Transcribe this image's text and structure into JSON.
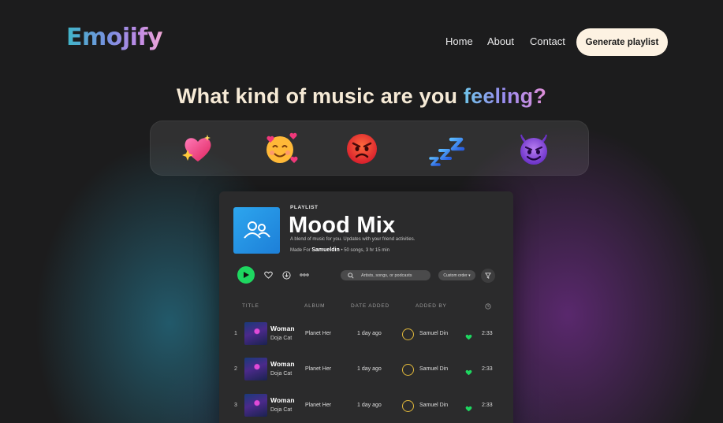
{
  "header": {
    "logo": "Emojify",
    "nav": [
      "Home",
      "About",
      "Contact"
    ],
    "cta": "Generate playlist"
  },
  "hero": {
    "question_main": "What kind of music are you ",
    "question_accent": "feeling?"
  },
  "moods": [
    {
      "icon": "sparkling-heart-icon"
    },
    {
      "icon": "smiling-face-with-hearts-icon"
    },
    {
      "icon": "angry-face-icon"
    },
    {
      "icon": "zzz-sleep-icon"
    },
    {
      "icon": "smiling-devil-icon"
    }
  ],
  "playlist": {
    "kicker": "PLAYLIST",
    "title": "Mood Mix",
    "description": "A blend of music for you. Updates with your friend activities.",
    "made_for_label": "Made For",
    "made_for_user": "Samueldin",
    "stats": "• 50 songs, 3 hr 15 min",
    "search_placeholder": "Artists, songs, or podcasts",
    "sort_label": "Custom order ▾",
    "columns": {
      "title": "TITLE",
      "album": "ALBUM",
      "date_added": "DATE ADDED",
      "added_by": "ADDED BY"
    },
    "tracks": [
      {
        "num": "1",
        "title": "Woman",
        "artist": "Doja Cat",
        "album": "Planet Her",
        "date": "1 day ago",
        "added_by": "Samuel Din",
        "duration": "2:33"
      },
      {
        "num": "2",
        "title": "Woman",
        "artist": "Doja Cat",
        "album": "Planet Her",
        "date": "1 day ago",
        "added_by": "Samuel Din",
        "duration": "2:33"
      },
      {
        "num": "3",
        "title": "Woman",
        "artist": "Doja Cat",
        "album": "Planet Her",
        "date": "1 day ago",
        "added_by": "Samuel Din",
        "duration": "2:33"
      }
    ]
  },
  "colors": {
    "background": "#1c1c1d",
    "cta_bg": "#fdf2e2",
    "spotify_green": "#1ed760",
    "cover_blue": "#2da6ee"
  }
}
